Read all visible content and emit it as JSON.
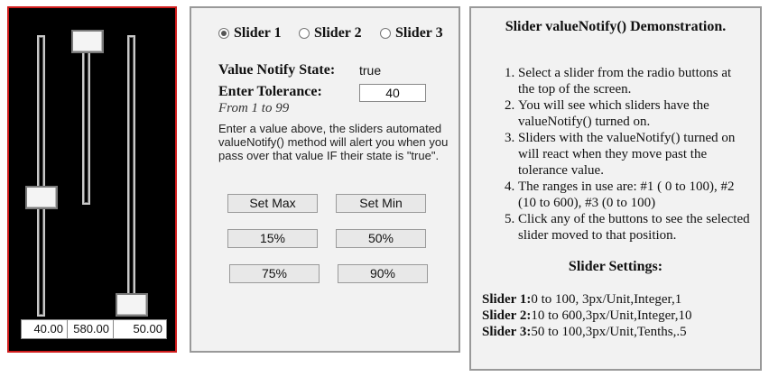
{
  "sliders": [
    {
      "readout": "40.00"
    },
    {
      "readout": "580.00"
    },
    {
      "readout": "50.00"
    }
  ],
  "controls": {
    "radio_options": [
      "Slider 1",
      "Slider 2",
      "Slider 3"
    ],
    "selected_radio": "Slider 1",
    "value_notify_label": "Value Notify State:",
    "value_notify_state": "true",
    "tolerance_label": "Enter Tolerance:",
    "tolerance_value": "40",
    "tolerance_range": "From 1 to 99",
    "help_text": "Enter a value above, the sliders automated valueNotify() method will alert you when you pass over that value IF their state is \"true\".",
    "buttons": {
      "set_max": "Set Max",
      "set_min": "Set Min",
      "p15": "15%",
      "p50": "50%",
      "p75": "75%",
      "p90": "90%"
    }
  },
  "description": {
    "title": "Slider valueNotify() Demonstration.",
    "steps": [
      "Select a slider from the radio buttons at the top of the screen.",
      "You will see which sliders have the valueNotify() turned on.",
      "Sliders with the valueNotify() turned on will react when they move past the tolerance value.",
      "The ranges in use are: #1 ( 0 to 100), #2 (10 to 600), #3 (0 to 100)",
      "Click any of the buttons to see the selected slider moved to that position."
    ],
    "settings_title": "Slider Settings:",
    "settings": [
      {
        "label": "Slider 1:",
        "value": "0 to 100, 3px/Unit,Integer,1"
      },
      {
        "label": "Slider 2:",
        "value": "10 to 600,3px/Unit,Integer,10"
      },
      {
        "label": "Slider 3:",
        "value": "50 to 100,3px/Unit,Tenths,.5"
      }
    ]
  },
  "colors": {
    "slider_panel_bg": "#000000",
    "slider_panel_border": "#d01c1c",
    "panel_bg": "#f2f2f2"
  }
}
